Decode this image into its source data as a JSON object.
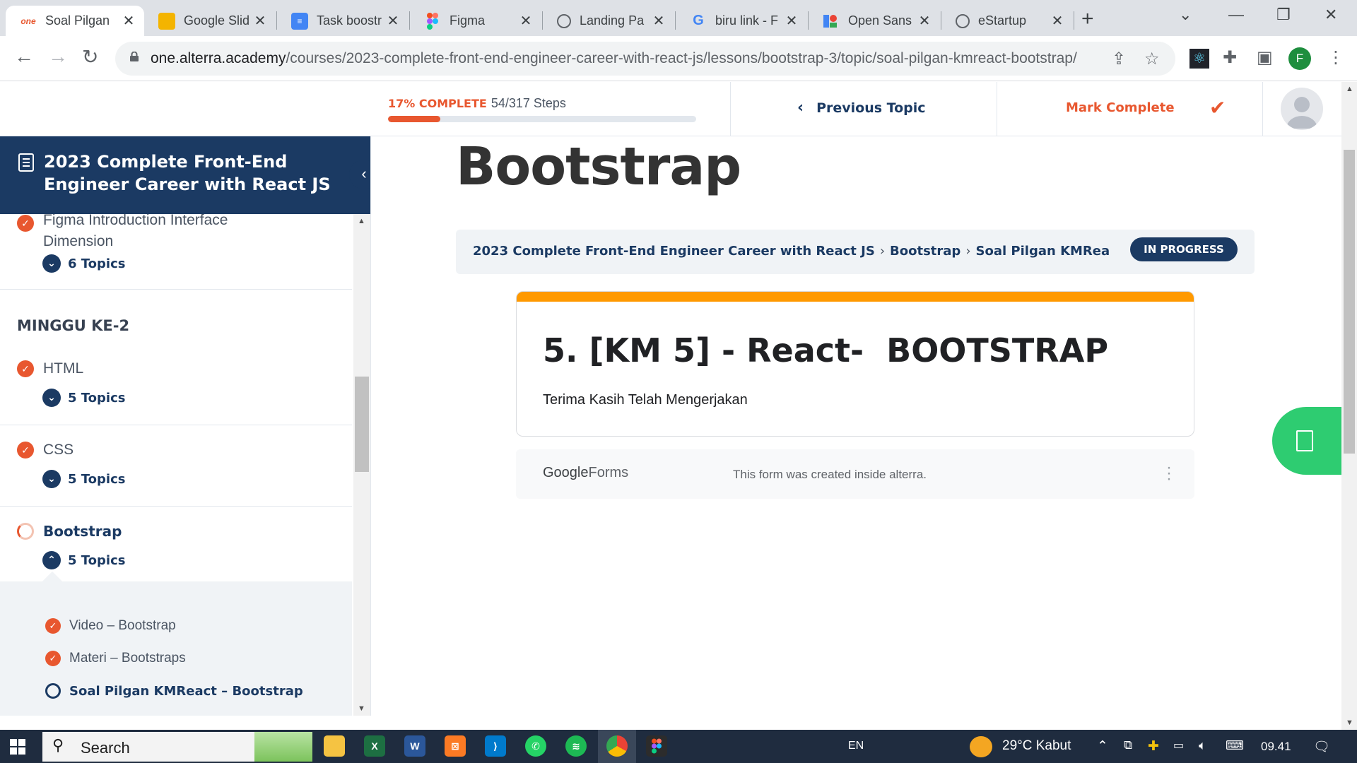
{
  "browser": {
    "tabs": [
      {
        "title": "Soal Pilgan",
        "favicon": "one-logo-icon",
        "active": true
      },
      {
        "title": "Google Slid",
        "favicon": "google-slides-icon"
      },
      {
        "title": "Task boostr",
        "favicon": "google-docs-icon"
      },
      {
        "title": "Figma",
        "favicon": "figma-icon"
      },
      {
        "title": "Landing Pa",
        "favicon": "globe-icon"
      },
      {
        "title": "biru link - F",
        "favicon": "google-icon"
      },
      {
        "title": "Open Sans",
        "favicon": "google-fonts-icon"
      },
      {
        "title": "eStartup",
        "favicon": "globe-icon"
      }
    ],
    "url_host": "one.alterra.academy",
    "url_path": "/courses/2023-complete-front-end-engineer-career-with-react-js/lessons/bootstrap-3/topic/soal-pilgan-kmreact-bootstrap/",
    "profile_initial": "F"
  },
  "header": {
    "progress_pct_label": "17% COMPLETE",
    "progress_steps": "54/317 Steps",
    "progress_value": 0.17,
    "previous_topic": "Previous Topic",
    "mark_complete": "Mark Complete"
  },
  "sidebar": {
    "course_title": "2023 Complete Front-End Engineer Career with React JS",
    "lessons": [
      {
        "title": "Figma Introduction Interface Dimension",
        "topics": "6 Topics",
        "status": "complete"
      },
      {
        "title": "HTML",
        "topics": "5 Topics",
        "status": "complete"
      },
      {
        "title": "CSS",
        "topics": "5 Topics",
        "status": "complete"
      },
      {
        "title": "Bootstrap",
        "topics": "5 Topics",
        "status": "in-progress"
      }
    ],
    "section_heading": "MINGGU KE-2",
    "topics": [
      {
        "title": "Video – Bootstrap",
        "status": "complete"
      },
      {
        "title": "Materi – Bootstraps",
        "status": "complete"
      },
      {
        "title": "Soal Pilgan KMReact – Bootstrap",
        "status": "current"
      }
    ]
  },
  "main": {
    "heading": "Bootstrap",
    "breadcrumb": [
      "2023 Complete Front-End Engineer Career with React JS",
      "Bootstrap",
      "Soal Pilgan KMReact – Boot..."
    ],
    "status_badge": "IN PROGRESS",
    "form": {
      "title": "5. [KM 5] - React-  BOOTSTRAP",
      "description": "Terima Kasih Telah Mengerjakan",
      "accent_color": "#ff9900"
    },
    "gforms": {
      "logo_google": "Google",
      "logo_forms": "Forms",
      "note": "This form was created inside alterra."
    }
  },
  "taskbar": {
    "search_label": "Search",
    "language": "EN",
    "weather": "29°C  Kabut",
    "time": "09.41"
  },
  "colors": {
    "brand_navy": "#1b3a63",
    "accent_orange": "#e8572f",
    "float_green": "#2ecc71"
  }
}
